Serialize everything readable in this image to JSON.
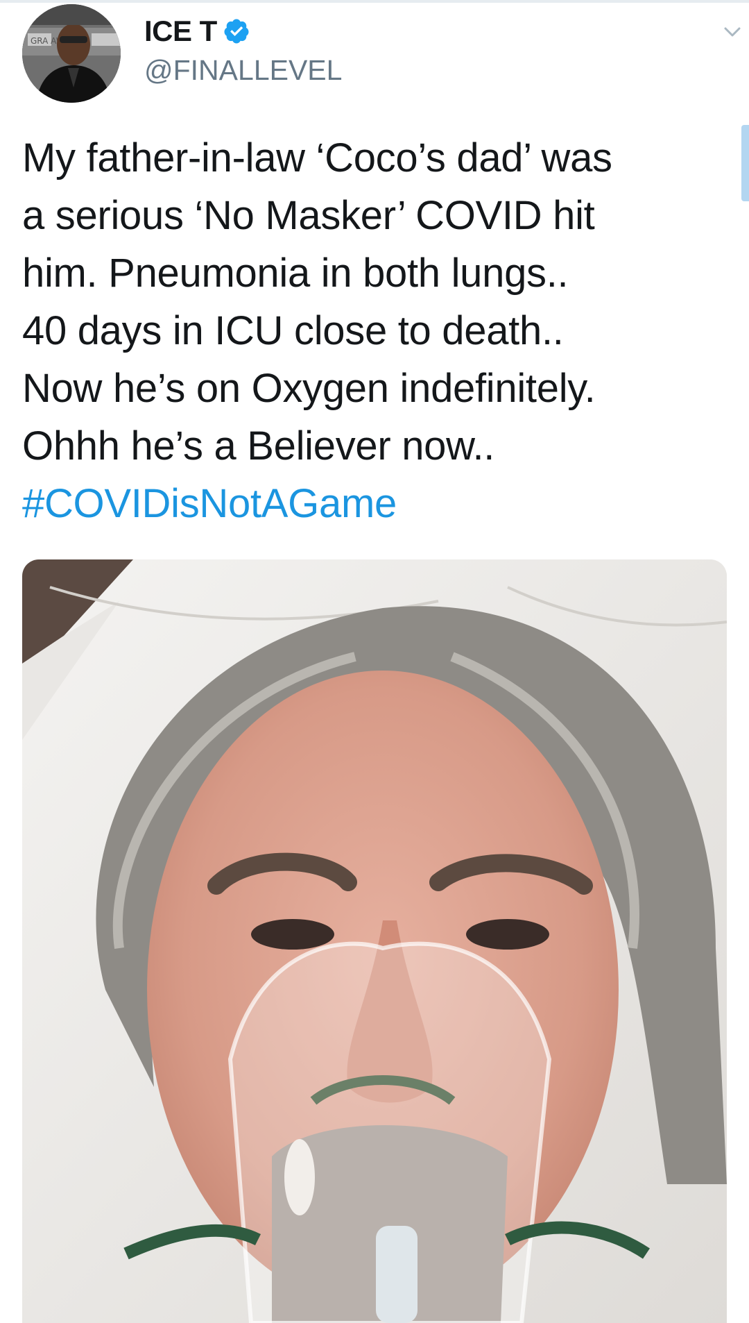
{
  "tweet": {
    "author": {
      "display_name": "ICE T",
      "handle": "@FINALLEVEL",
      "verified": true,
      "avatar_text": "GRA AWAR"
    },
    "text_lines": [
      "My father-in-law ‘Coco’s dad’ was",
      "a serious ‘No Masker’  COVID hit",
      "him. Pneumonia in both lungs..",
      "40 days in ICU close to death..",
      "Now he’s on Oxygen indefinitely.",
      "Ohhh he’s a Believer now.."
    ],
    "hashtag": "#COVIDisNotAGame",
    "icons": {
      "verified": "verified-badge-icon",
      "menu": "chevron-down-icon"
    }
  },
  "colors": {
    "link": "#1b95e0",
    "verified": "#1da1f2",
    "handle": "#657786",
    "text": "#14171a"
  }
}
